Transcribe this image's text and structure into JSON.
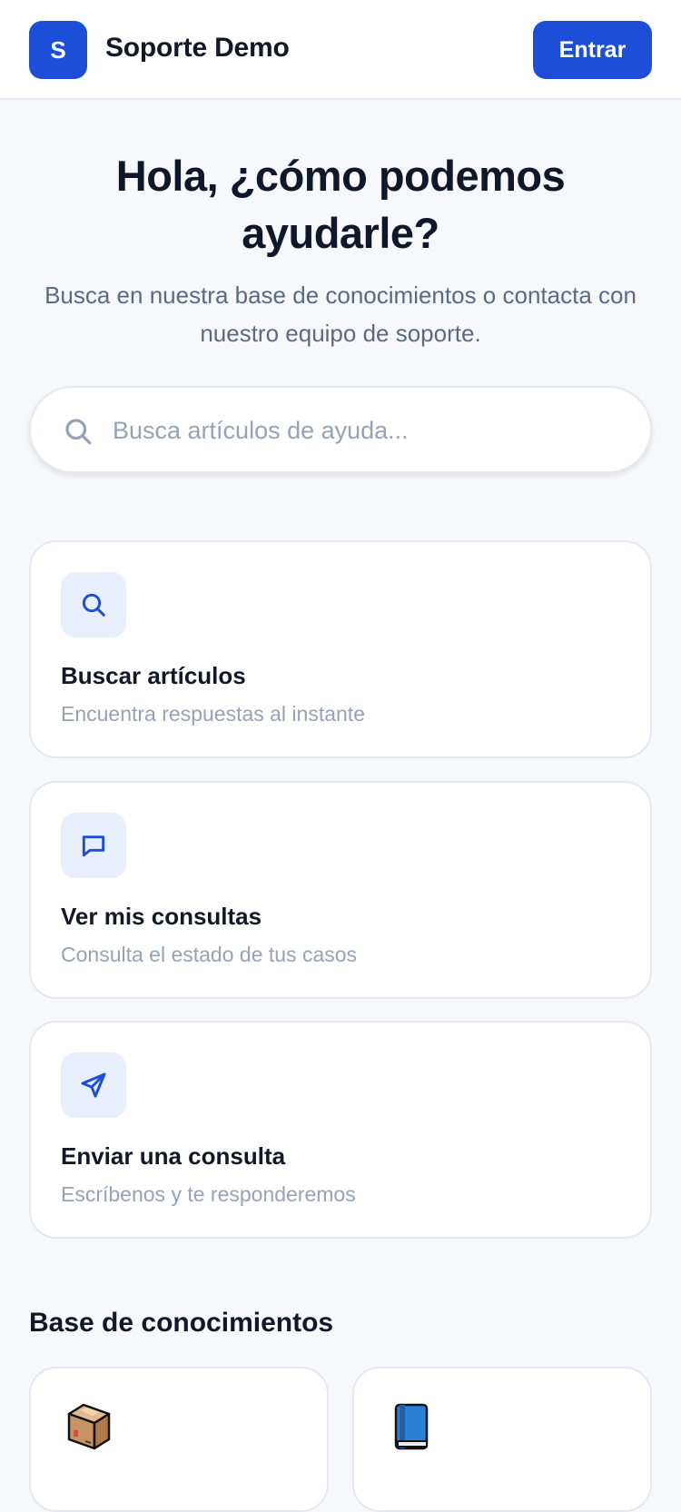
{
  "header": {
    "badge_letter": "S",
    "brand_name": "Soporte Demo",
    "login_label": "Entrar"
  },
  "hero": {
    "title": "Hola, ¿cómo podemos ayudarle?",
    "subtitle": "Busca en nuestra base de conocimientos o contacta con nuestro equipo de soporte."
  },
  "search": {
    "placeholder": "Busca artículos de ayuda...",
    "value": ""
  },
  "actions": [
    {
      "icon": "search-icon",
      "title": "Buscar artículos",
      "description": "Encuentra respuestas al instante"
    },
    {
      "icon": "message-icon",
      "title": "Ver mis consultas",
      "description": "Consulta el estado de tus casos"
    },
    {
      "icon": "send-icon",
      "title": "Enviar una consulta",
      "description": "Escríbenos y te responderemos"
    }
  ],
  "knowledge_base": {
    "heading": "Base de conocimientos",
    "categories": [
      {
        "icon": "package-icon"
      },
      {
        "icon": "book-icon"
      }
    ]
  },
  "colors": {
    "accent": "#1d4ed8",
    "icon_bg": "#e8eefb",
    "page_bg": "#f6f8fb"
  }
}
